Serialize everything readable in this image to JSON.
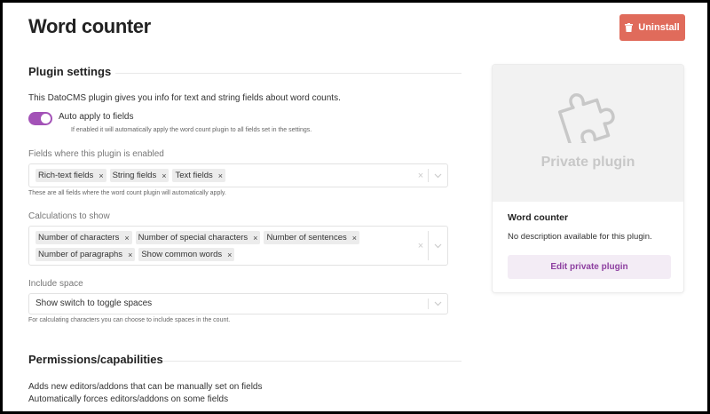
{
  "page": {
    "title": "Word counter"
  },
  "header": {
    "uninstall_label": "Uninstall"
  },
  "plugin_settings": {
    "heading": "Plugin settings",
    "description": "This DatoCMS plugin gives you info for text and string fields about word counts.",
    "auto_apply": {
      "label": "Auto apply to fields",
      "hint": "If enabled it will automatically apply the word count plugin to all fields set in the settings.",
      "enabled": true
    },
    "fields": {
      "label": "Fields where this plugin is enabled",
      "chips": [
        "Rich-text fields",
        "String fields",
        "Text fields"
      ],
      "hint": "These are all fields where the word count plugin will automatically apply."
    },
    "calculations": {
      "label": "Calculations to show",
      "chips": [
        "Number of characters",
        "Number of special characters",
        "Number of sentences",
        "Number of paragraphs",
        "Show common words"
      ]
    },
    "include_space": {
      "label": "Include space",
      "value": "Show switch to toggle spaces",
      "hint": "For calculating characters you can choose to include spaces in the count."
    }
  },
  "permissions": {
    "heading": "Permissions/capabilities",
    "lines": [
      "Adds new editors/addons that can be manually set on fields",
      "Automatically forces editors/addons on some fields"
    ]
  },
  "card": {
    "badge": "Private plugin",
    "name": "Word counter",
    "description": "No description available for this plugin.",
    "button_label": "Edit private plugin",
    "icon": "puzzle-piece-icon"
  },
  "colors": {
    "uninstall_bg": "#e06b5b",
    "toggle_on": "#a352b7",
    "edit_button_bg": "#f3ecf5",
    "edit_button_text": "#8d3fa0"
  },
  "chip_remove_glyph": "×"
}
